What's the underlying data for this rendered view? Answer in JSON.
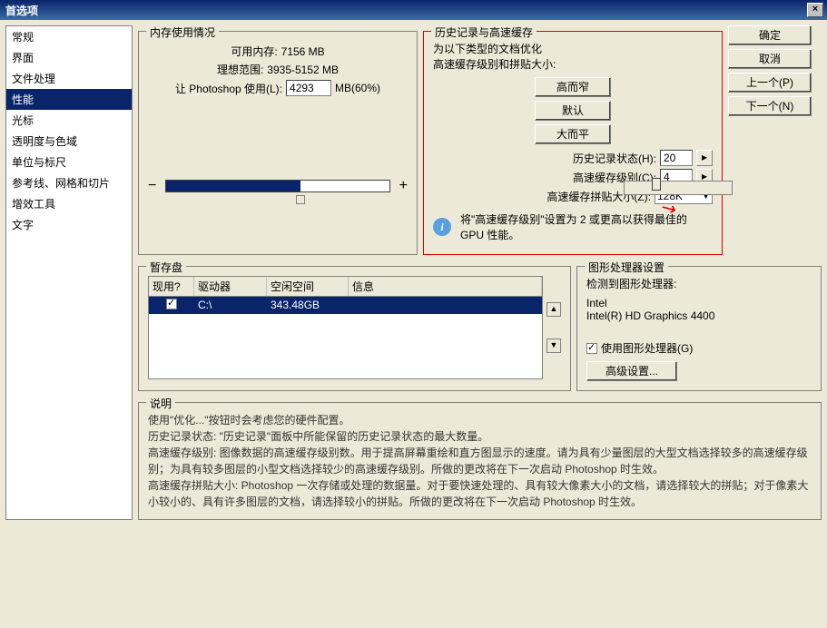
{
  "window": {
    "title": "首选项"
  },
  "sidebar": {
    "items": [
      {
        "label": "常规"
      },
      {
        "label": "界面"
      },
      {
        "label": "文件处理"
      },
      {
        "label": "性能",
        "selected": true
      },
      {
        "label": "光标"
      },
      {
        "label": "透明度与色域"
      },
      {
        "label": "单位与标尺"
      },
      {
        "label": "参考线、网格和切片"
      },
      {
        "label": "增效工具"
      },
      {
        "label": "文字"
      }
    ]
  },
  "buttons": {
    "ok": "确定",
    "cancel": "取消",
    "prev": "上一个(P)",
    "next": "下一个(N)"
  },
  "memory": {
    "legend": "内存使用情况",
    "available_label": "可用内存:",
    "available_value": "7156 MB",
    "ideal_label": "理想范围:",
    "ideal_value": "3935-5152 MB",
    "let_label": "让 Photoshop 使用(L):",
    "let_value": "4293",
    "let_unit": "MB(60%)",
    "minus": "−",
    "plus": "+"
  },
  "history": {
    "legend": "历史记录与高速缓存",
    "optimize_label": "为以下类型的文档优化",
    "cache_label": "高速缓存级别和拼贴大小:",
    "btn_tall": "高而窄",
    "btn_default": "默认",
    "btn_wide": "大而平",
    "states_label": "历史记录状态(H):",
    "states_value": "20",
    "levels_label": "高速缓存级别(C):",
    "levels_value": "4",
    "tile_label": "高速缓存拼贴大小(Z):",
    "tile_value": "128K",
    "info": "将\"高速缓存级别\"设置为 2 或更高以获得最佳的 GPU 性能。"
  },
  "scratch": {
    "legend": "暂存盘",
    "cols": {
      "active": "现用?",
      "drive": "驱动器",
      "free": "空闲空间",
      "info": "信息"
    },
    "rows": [
      {
        "active": true,
        "drive": "C:\\",
        "free": "343.48GB",
        "info": ""
      }
    ]
  },
  "gpu": {
    "legend": "图形处理器设置",
    "detected_label": "检测到图形处理器:",
    "vendor": "Intel",
    "model": "Intel(R) HD Graphics 4400",
    "use_label": "使用图形处理器(G)",
    "use_checked": true,
    "advanced": "高级设置..."
  },
  "desc": {
    "legend": "说明",
    "lines": [
      "使用\"优化...\"按钮时会考虑您的硬件配置。",
      "历史记录状态: \"历史记录\"面板中所能保留的历史记录状态的最大数量。",
      "高速缓存级别: 图像数据的高速缓存级别数。用于提高屏幕重绘和直方图显示的速度。请为具有少量图层的大型文档选择较多的高速缓存级别；为具有较多图层的小型文档选择较少的高速缓存级别。所做的更改将在下一次启动 Photoshop 时生效。",
      "高速缓存拼贴大小: Photoshop 一次存储或处理的数据量。对于要快速处理的、具有较大像素大小的文档，请选择较大的拼贴；对于像素大小较小的、具有许多图层的文档，请选择较小的拼贴。所做的更改将在下一次启动 Photoshop 时生效。"
    ]
  }
}
